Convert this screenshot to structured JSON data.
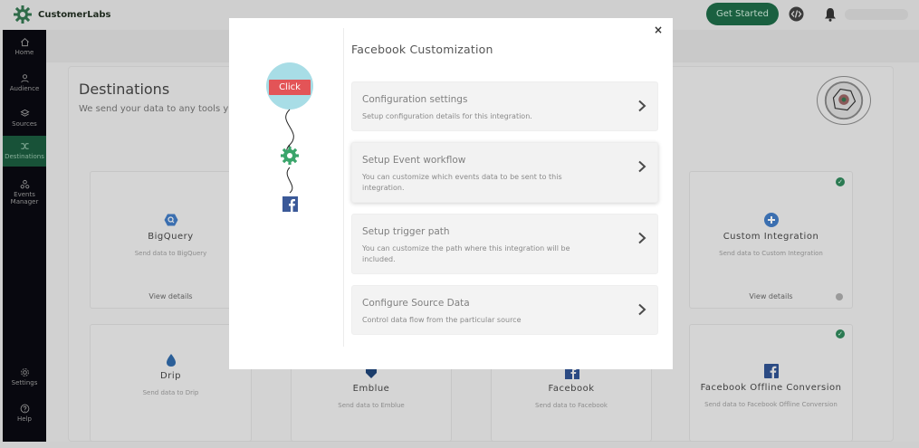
{
  "topbar": {
    "brand_name": "CustomerLabs",
    "get_started_label": "Get Started",
    "icons": [
      "code-icon",
      "bell-icon"
    ]
  },
  "sidebar": {
    "items": [
      {
        "label": "Home",
        "icon": "home-icon"
      },
      {
        "label": "Audience",
        "icon": "audience-icon"
      },
      {
        "label": "Sources",
        "icon": "sources-icon"
      },
      {
        "label": "Destinations",
        "icon": "destinations-icon",
        "active": true
      },
      {
        "label": "Events Manager",
        "label_lines": [
          "Events",
          "Manager"
        ],
        "icon": "events-manager-icon"
      },
      {
        "label": "Settings",
        "icon": "settings-icon"
      },
      {
        "label": "Help",
        "icon": "help-icon"
      }
    ]
  },
  "main": {
    "title": "Destinations",
    "subtitle": "We send your data to any tools y",
    "cards": [
      {
        "title": "BigQuery",
        "desc": "Send data to BigQuery",
        "link": "View details",
        "icon": "bigquery-icon"
      },
      {
        "title": "Custom Integration",
        "desc": "Send data to Custom Integration",
        "link": "View details",
        "icon": "plus-icon",
        "checked": true
      },
      {
        "title": "Drip",
        "desc": "Send data to Drip",
        "icon": "drip-icon"
      },
      {
        "title": "Emblue",
        "desc": "Send data to Emblue",
        "icon": "emblue-icon"
      },
      {
        "title": "Facebook",
        "desc": "Send data to Facebook",
        "icon": "facebook-icon"
      },
      {
        "title": "Facebook Offline Conversion",
        "desc": "Send data to Facebook Offline Conversion",
        "icon": "facebook-icon",
        "checked": true
      }
    ]
  },
  "modal": {
    "title": "Facebook Customization",
    "click_label": "Click",
    "options": [
      {
        "title": "Configuration settings",
        "desc": "Setup configuration details for this integration."
      },
      {
        "title": "Setup Event workflow",
        "desc": "You can customize which events data to be sent to this integration."
      },
      {
        "title": "Setup trigger path",
        "desc": "You can customize the path where this integration will be included."
      },
      {
        "title": "Configure Source Data",
        "desc": "Control data flow from the particular source"
      }
    ]
  },
  "colors": {
    "brand_green": "#1a6040",
    "click_red": "#e35457",
    "facebook_blue": "#3b5998",
    "gear_green": "#3aa56b"
  }
}
